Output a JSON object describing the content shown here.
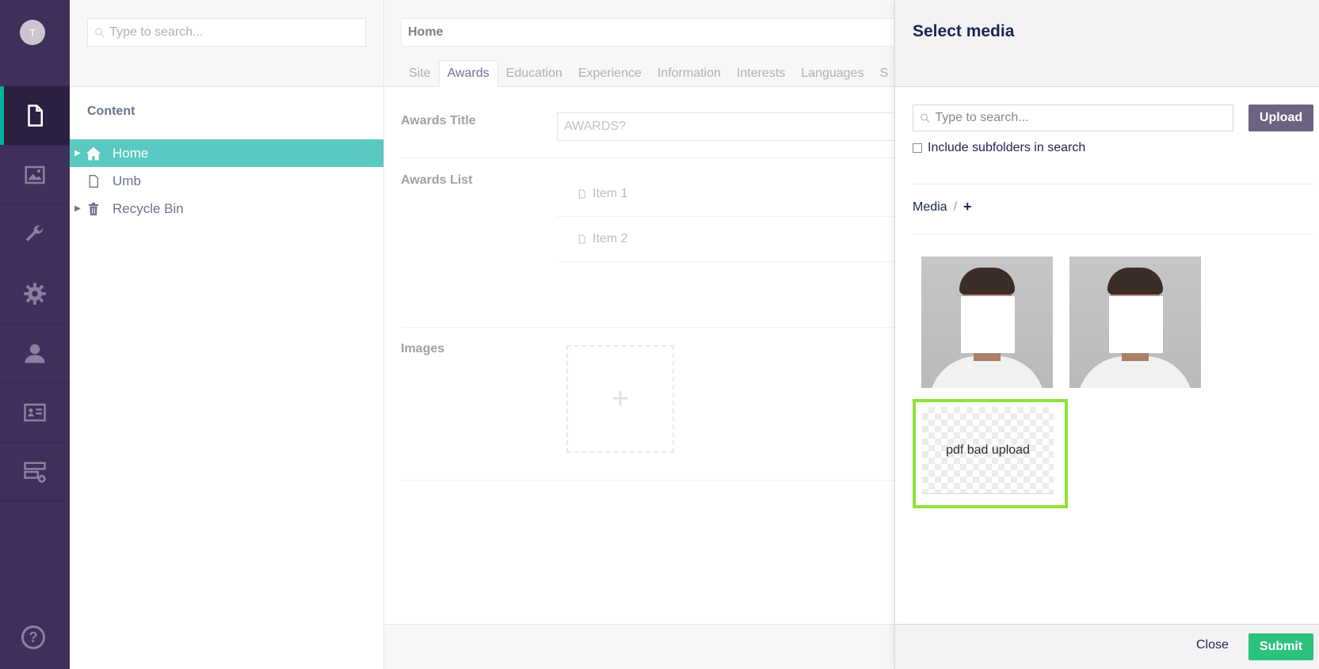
{
  "user": {
    "initial": "T"
  },
  "tree": {
    "search_placeholder": "Type to search...",
    "title": "Content",
    "nodes": [
      {
        "label": "Home",
        "icon": "home-icon",
        "selected": true
      },
      {
        "label": "Umb",
        "icon": "document-icon"
      },
      {
        "label": "Recycle Bin",
        "icon": "trash-icon"
      }
    ]
  },
  "editor": {
    "node_name": "Home",
    "tabs": [
      "Site",
      "Awards",
      "Education",
      "Experience",
      "Information",
      "Interests",
      "Languages",
      "S"
    ],
    "active_tab": "Awards",
    "awards_title_label": "Awards Title",
    "awards_title_value": "AWARDS?",
    "awards_list_label": "Awards List",
    "awards_list_items": [
      "Item 1",
      "Item 2"
    ],
    "images_label": "Images",
    "add_symbol": "+"
  },
  "dialog": {
    "title": "Select media",
    "search_placeholder": "Type to search...",
    "upload_label": "Upload",
    "subfolders_label": "Include subfolders in search",
    "breadcrumb_root": "Media",
    "breadcrumb_sep": "/",
    "breadcrumb_add": "+",
    "broken_item_alt": "pdf bad upload",
    "close_label": "Close",
    "submit_label": "Submit"
  },
  "colors": {
    "sidebar": "#3f2f5b",
    "accent": "#00ada0",
    "upload_button": "#6c6281",
    "submit_button": "#2bc37c",
    "selected_outline": "#8fe23b"
  }
}
